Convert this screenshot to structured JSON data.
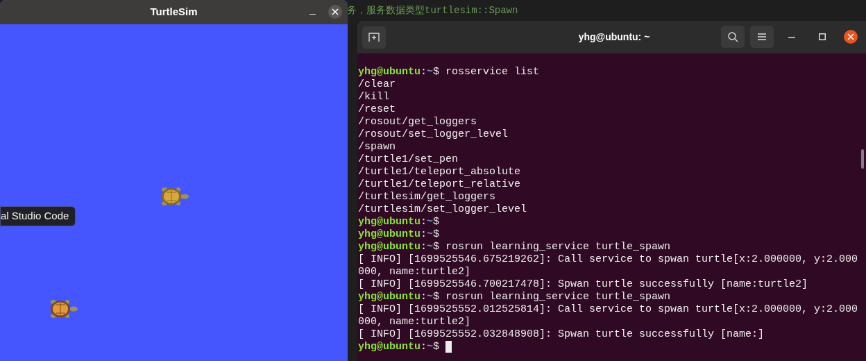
{
  "editor_background": {
    "top_line": "务，服务数据类型turtlesim::Spawn"
  },
  "turtlesim": {
    "title": "TurtleSim",
    "tooltip": "al Studio Code"
  },
  "terminal": {
    "title": "yhg@ubuntu: ~",
    "lines": [
      {
        "kind": "prompt",
        "user": "yhg@ubuntu",
        "sep": ":",
        "path": "~",
        "symbol": "$",
        "command": " rosservice list"
      },
      {
        "kind": "output",
        "text": "/clear"
      },
      {
        "kind": "output",
        "text": "/kill"
      },
      {
        "kind": "output",
        "text": "/reset"
      },
      {
        "kind": "output",
        "text": "/rosout/get_loggers"
      },
      {
        "kind": "output",
        "text": "/rosout/set_logger_level"
      },
      {
        "kind": "output",
        "text": "/spawn"
      },
      {
        "kind": "output",
        "text": "/turtle1/set_pen"
      },
      {
        "kind": "output",
        "text": "/turtle1/teleport_absolute"
      },
      {
        "kind": "output",
        "text": "/turtle1/teleport_relative"
      },
      {
        "kind": "output",
        "text": "/turtlesim/get_loggers"
      },
      {
        "kind": "output",
        "text": "/turtlesim/set_logger_level"
      },
      {
        "kind": "prompt",
        "user": "yhg@ubuntu",
        "sep": ":",
        "path": "~",
        "symbol": "$"
      },
      {
        "kind": "prompt",
        "user": "yhg@ubuntu",
        "sep": ":",
        "path": "~",
        "symbol": "$"
      },
      {
        "kind": "prompt",
        "user": "yhg@ubuntu",
        "sep": ":",
        "path": "~",
        "symbol": "$",
        "command": " rosrun learning_service turtle_spawn"
      },
      {
        "kind": "output",
        "text": "[ INFO] [1699525546.675219262]: Call service to spwan turtle[x:2.000000, y:2.000"
      },
      {
        "kind": "output",
        "text": "000, name:turtle2]"
      },
      {
        "kind": "output",
        "text": "[ INFO] [1699525546.700217478]: Spwan turtle successfully [name:turtle2]"
      },
      {
        "kind": "prompt",
        "user": "yhg@ubuntu",
        "sep": ":",
        "path": "~",
        "symbol": "$",
        "command": " rosrun learning_service turtle_spawn"
      },
      {
        "kind": "output",
        "text": "[ INFO] [1699525552.012525814]: Call service to spwan turtle[x:2.000000, y:2.000"
      },
      {
        "kind": "output",
        "text": "000, name:turtle2]"
      },
      {
        "kind": "output",
        "text": "[ INFO] [1699525552.032848908]: Spwan turtle successfully [name:]"
      },
      {
        "kind": "prompt",
        "user": "yhg@ubuntu",
        "sep": ":",
        "path": "~",
        "symbol": "$",
        "cursor": true
      }
    ]
  }
}
